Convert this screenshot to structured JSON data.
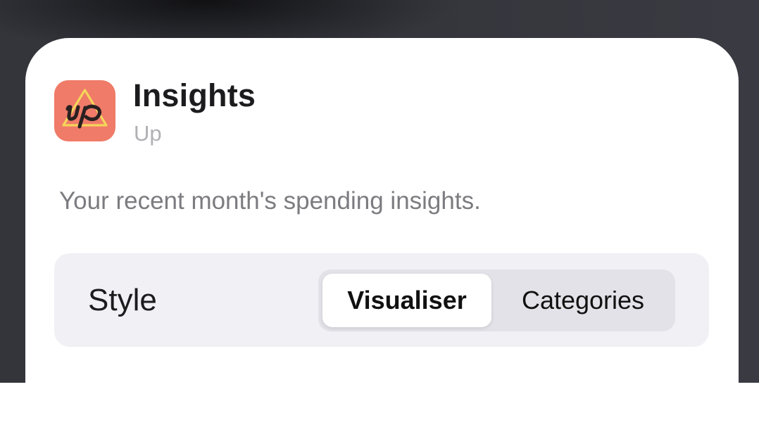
{
  "widget": {
    "title": "Insights",
    "app_name": "Up",
    "description": "Your recent month's spending insights.",
    "icon": "up-app-icon",
    "icon_wordmark": "up"
  },
  "settings": {
    "style_label": "Style",
    "options": [
      "Visualiser",
      "Categories"
    ],
    "selected": "Visualiser"
  },
  "colors": {
    "icon_background": "#ef7b68",
    "icon_triangle": "#f5d45a",
    "segment_selected": "#ffffff",
    "segment_track": "#e2e2e8",
    "row_background": "#f0f0f5"
  }
}
